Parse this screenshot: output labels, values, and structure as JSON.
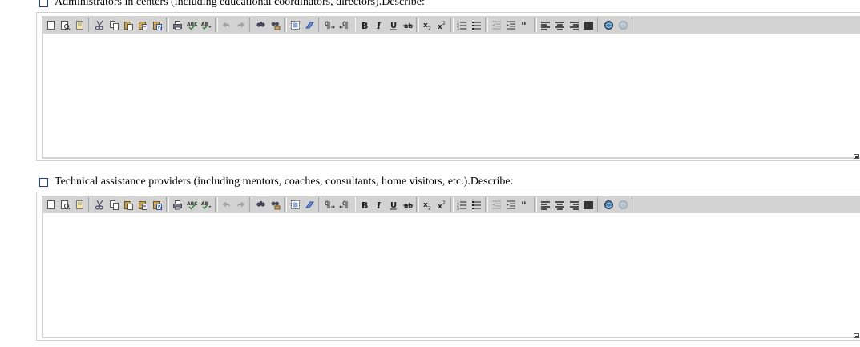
{
  "questions": [
    {
      "label": "Administrators in centers (including educational coordinators, directors).Describe:"
    },
    {
      "label": "Technical assistance providers (including mentors, coaches, consultants, home visitors, etc.).Describe:"
    }
  ],
  "toolbar": {
    "groups": [
      [
        "new-page-icon",
        "preview-icon",
        "template-icon"
      ],
      [
        "cut-icon",
        "copy-icon",
        "paste-icon",
        "paste-text-icon",
        "paste-word-icon"
      ],
      [
        "print-icon",
        "spellcheck-icon",
        "spellcheck-dropdown-icon"
      ],
      [
        "undo-icon",
        "redo-icon"
      ],
      [
        "find-icon",
        "replace-icon"
      ],
      [
        "select-all-icon",
        "remove-format-icon"
      ],
      [
        "ltr-icon",
        "rtl-icon"
      ],
      [
        "bold-icon",
        "italic-icon",
        "underline-icon",
        "strikethrough-icon"
      ],
      [
        "subscript-icon",
        "superscript-icon"
      ],
      [
        "numbered-list-icon",
        "bulleted-list-icon"
      ],
      [
        "outdent-icon",
        "indent-icon",
        "blockquote-icon"
      ],
      [
        "align-left-icon",
        "align-center-icon",
        "align-right-icon",
        "justify-icon"
      ],
      [
        "link-icon",
        "unlink-icon"
      ]
    ],
    "disabled": [
      "undo-icon",
      "redo-icon",
      "outdent-icon",
      "unlink-icon"
    ]
  },
  "colors": {
    "toolbar_bg": "#d3d3d3",
    "checkbox_border": "#1f3f8f",
    "editor_border": "#d0d0d0"
  }
}
